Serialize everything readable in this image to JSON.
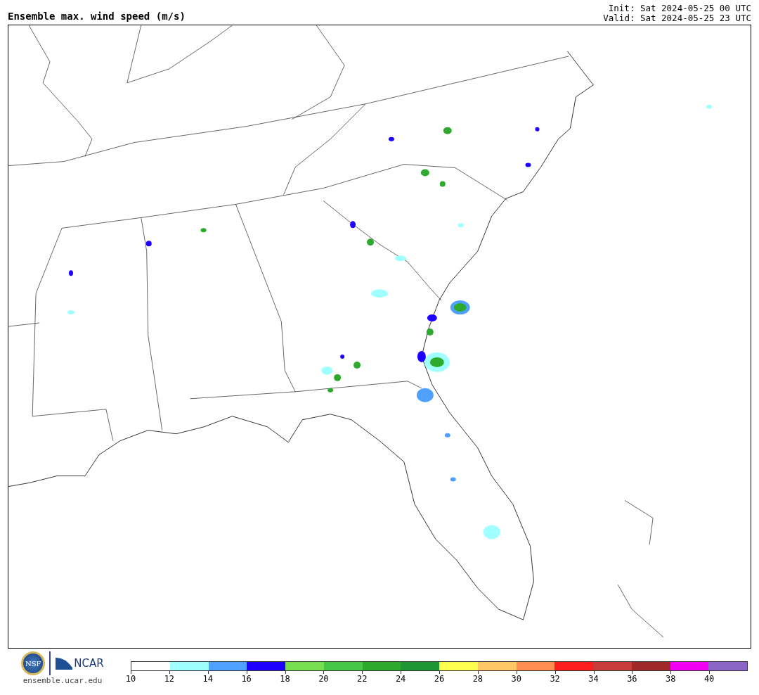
{
  "title": "Ensemble max. wind speed (m/s)",
  "init": "Init: Sat 2024-05-25 00 UTC",
  "valid": "Valid: Sat 2024-05-25 23 UTC",
  "logos": {
    "nsf": "NSF",
    "ncar": "NCAR",
    "url": "ensemble.ucar.edu"
  },
  "colorbar": {
    "segments": [
      {
        "color": "#ffffff"
      },
      {
        "color": "#a0ffff"
      },
      {
        "color": "#50a0ff"
      },
      {
        "color": "#1e00ff"
      },
      {
        "color": "#78e050"
      },
      {
        "color": "#46c846"
      },
      {
        "color": "#2daa2d"
      },
      {
        "color": "#1e9632"
      },
      {
        "color": "#ffff50"
      },
      {
        "color": "#ffc864"
      },
      {
        "color": "#ff8c50"
      },
      {
        "color": "#ff1e1e"
      },
      {
        "color": "#c83c3c"
      },
      {
        "color": "#a02828"
      },
      {
        "color": "#f000f0"
      },
      {
        "color": "#8c64c8"
      }
    ],
    "ticks": [
      "10",
      "12",
      "14",
      "16",
      "18",
      "20",
      "22",
      "24",
      "26",
      "28",
      "30",
      "32",
      "34",
      "36",
      "38",
      "40"
    ]
  }
}
